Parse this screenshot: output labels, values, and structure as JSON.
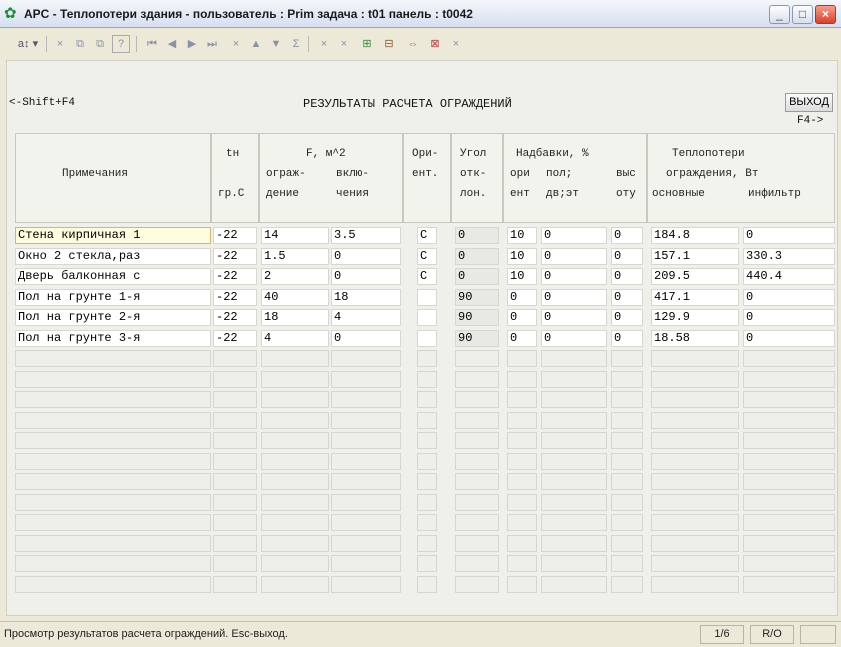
{
  "window": {
    "title": "APC - Теплопотери здания -   пользователь : Prim  задача : t01  панель : t0042",
    "minimize_label": "_",
    "maximize_label": "□",
    "close_label": "×"
  },
  "toolbar": {
    "sort_label": "a↕ ▾",
    "items": [
      "×",
      "⧉",
      "⧉",
      "?",
      "⏮",
      "◀",
      "▶",
      "⏭",
      "×",
      "▲",
      "▼",
      "Σ",
      "×",
      "×",
      "⊞",
      "⊟",
      "⇔",
      "⊠",
      "×"
    ]
  },
  "panel": {
    "nav_left": "<-Shift+F4",
    "heading": "РЕЗУЛЬТАТЫ РАСЧЕТА ОГРАЖДЕНИЙ",
    "exit_label": "ВЫХОД",
    "nav_right": "F4->"
  },
  "columns": {
    "note": "Примечания",
    "tn": [
      "tн",
      "",
      "гр.С"
    ],
    "f_top": "F, м^2",
    "f_a": [
      "",
      "ограж-",
      "дение"
    ],
    "f_b": [
      "",
      "вклю-",
      "чения"
    ],
    "orient": [
      "Ори-",
      "ент."
    ],
    "angle": [
      "Угол",
      "отк-",
      "лон."
    ],
    "add_top": "Надбавки, %",
    "add_a": [
      "",
      "ори",
      "ент"
    ],
    "add_b": [
      "",
      "пол;",
      "дв;эт"
    ],
    "add_c": [
      "",
      "выс",
      "оту"
    ],
    "loss_top": "Теплопотери",
    "loss_mid": "ограждения, Вт",
    "loss_a": "основные",
    "loss_b": "инфильтр"
  },
  "rows": [
    {
      "note": "Стена кирпичная 1",
      "tn": "-22",
      "f1": "14",
      "f2": "3.5",
      "orient": "С",
      "angle": "0",
      "a1": "10",
      "a2": "0",
      "a3": "0",
      "main": "184.8",
      "infil": "0"
    },
    {
      "note": "Окно 2 стекла,раз",
      "tn": "-22",
      "f1": "1.5",
      "f2": "0",
      "orient": "С",
      "angle": "0",
      "a1": "10",
      "a2": "0",
      "a3": "0",
      "main": "157.1",
      "infil": "330.3"
    },
    {
      "note": "Дверь балконная с",
      "tn": "-22",
      "f1": "2",
      "f2": "0",
      "orient": "С",
      "angle": "0",
      "a1": "10",
      "a2": "0",
      "a3": "0",
      "main": "209.5",
      "infil": "440.4"
    },
    {
      "note": "Пол на грунте 1-я",
      "tn": "-22",
      "f1": "40",
      "f2": "18",
      "orient": "",
      "angle": "90",
      "a1": "0",
      "a2": "0",
      "a3": "0",
      "main": "417.1",
      "infil": "0"
    },
    {
      "note": "Пол на грунте 2-я",
      "tn": "-22",
      "f1": "18",
      "f2": "4",
      "orient": "",
      "angle": "90",
      "a1": "0",
      "a2": "0",
      "a3": "0",
      "main": "129.9",
      "infil": "0"
    },
    {
      "note": "Пол на грунте 3-я",
      "tn": "-22",
      "f1": "4",
      "f2": "0",
      "orient": "",
      "angle": "90",
      "a1": "0",
      "a2": "0",
      "a3": "0",
      "main": "18.58",
      "infil": "0"
    }
  ],
  "status": {
    "message": "Просмотр результатов расчета ограждений. Esc-выход.",
    "record": "1/6",
    "mode": "R/O"
  }
}
